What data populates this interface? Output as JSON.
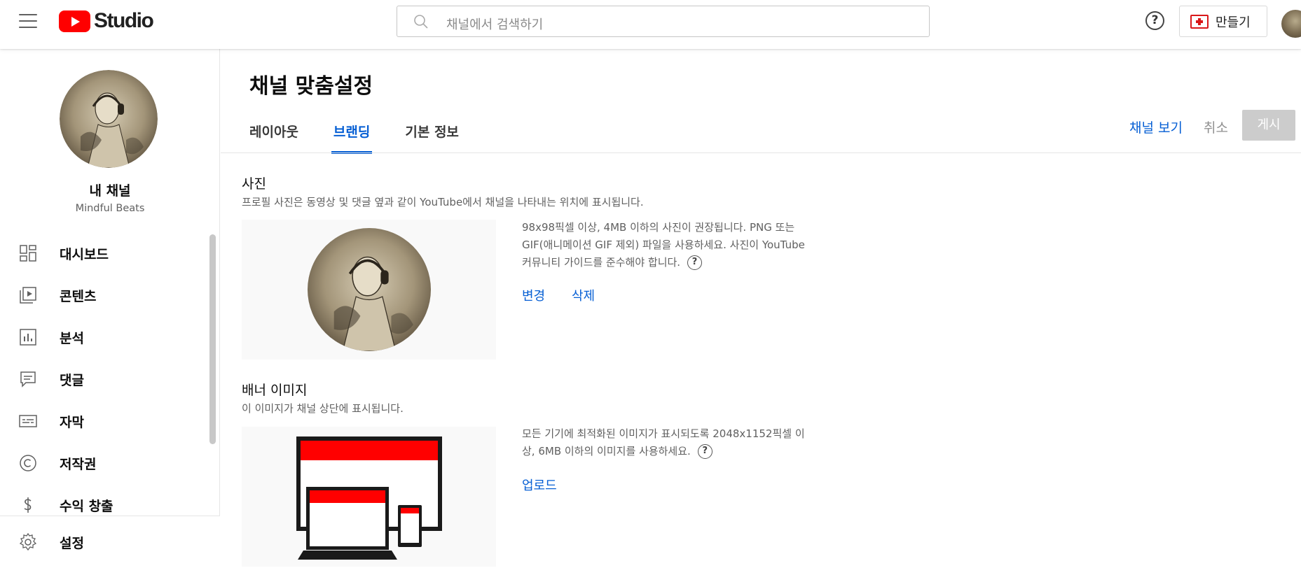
{
  "header": {
    "logo_text": "Studio",
    "search_placeholder": "채널에서 검색하기",
    "help_label": "?",
    "create_label": "만들기"
  },
  "sidebar": {
    "channel_title": "내 채널",
    "channel_name": "Mindful Beats",
    "items": [
      {
        "label": "대시보드",
        "icon": "dashboard-icon"
      },
      {
        "label": "콘텐츠",
        "icon": "content-icon"
      },
      {
        "label": "분석",
        "icon": "analytics-icon"
      },
      {
        "label": "댓글",
        "icon": "comments-icon"
      },
      {
        "label": "자막",
        "icon": "subtitles-icon"
      },
      {
        "label": "저작권",
        "icon": "copyright-icon"
      },
      {
        "label": "수익 창출",
        "icon": "dollar-icon"
      }
    ],
    "settings_label": "설정"
  },
  "main": {
    "page_title": "채널 맞춤설정",
    "tabs": [
      {
        "label": "레이아웃",
        "active": false
      },
      {
        "label": "브랜딩",
        "active": true
      },
      {
        "label": "기본 정보",
        "active": false
      }
    ],
    "view_channel": "채널 보기",
    "cancel": "취소",
    "publish": "게시",
    "photo": {
      "title": "사진",
      "description": "프로필 사진은 동영상 및 댓글 옆과 같이 YouTube에서 채널을 나타내는 위치에 표시됩니다.",
      "info": "98x98픽셀 이상, 4MB 이하의 사진이 권장됩니다. PNG 또는 GIF(애니메이션 GIF 제외) 파일을 사용하세요. 사진이 YouTube 커뮤니티 가이드를 준수해야 합니다.",
      "change": "변경",
      "delete": "삭제"
    },
    "banner": {
      "title": "배너 이미지",
      "description": "이 이미지가 채널 상단에 표시됩니다.",
      "info": "모든 기기에 최적화된 이미지가 표시되도록 2048x1152픽셀 이상, 6MB 이하의 이미지를 사용하세요.",
      "upload": "업로드"
    }
  },
  "colors": {
    "accent": "#065fd4",
    "brand": "#ff0000",
    "disabled_button": "#cccccc"
  }
}
